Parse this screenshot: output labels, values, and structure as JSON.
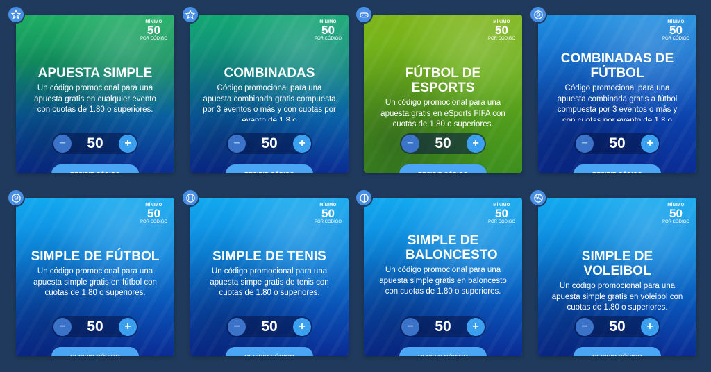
{
  "cards": [
    {
      "icon": "star-icon",
      "minimo_label": "MÍNIMO",
      "minimo_value": "50",
      "minimo_sub": "POR CÓDIGO",
      "title": "APUESTA SIMPLE",
      "description": "Un código promocional para una apuesta gratis en cualquier evento con cuotas de 1.80 o superiores.",
      "stepper_value": "50",
      "button_label": "RECIBIR CÓDIGO"
    },
    {
      "icon": "star-icon",
      "minimo_label": "MÍNIMO",
      "minimo_value": "50",
      "minimo_sub": "POR CÓDIGO",
      "title": "COMBINADAS",
      "description": "Código promocional para una apuesta combinada gratis compuesta por 3 eventos o más y con cuotas por evento de 1.8 o",
      "stepper_value": "50",
      "button_label": "RECIBIR CÓDIGO"
    },
    {
      "icon": "esports-icon",
      "minimo_label": "MÍNIMO",
      "minimo_value": "50",
      "minimo_sub": "POR CÓDIGO",
      "title": "FÚTBOL DE ESPORTS",
      "description": "Un código promocional para una apuesta gratis en eSports FIFA con cuotas de 1.80 o superiores.",
      "stepper_value": "50",
      "button_label": "RECIBIR CÓDIGO"
    },
    {
      "icon": "soccer-ball-icon",
      "minimo_label": "MÍNIMO",
      "minimo_value": "50",
      "minimo_sub": "POR CÓDIGO",
      "title": "COMBINADAS DE FÚTBOL",
      "description": "Código promocional para una apuesta combinada gratis a fútbol compuesta por 3 eventos o más y con cuotas por evento de 1.8 o",
      "stepper_value": "50",
      "button_label": "RECIBIR CÓDIGO"
    },
    {
      "icon": "soccer-ball-icon",
      "minimo_label": "MÍNIMO",
      "minimo_value": "50",
      "minimo_sub": "POR CÓDIGO",
      "title": "SIMPLE DE FÚTBOL",
      "description": "Un código promocional para una apuesta simple gratis en fútbol con cuotas de 1.80 o superiores.",
      "stepper_value": "50",
      "button_label": "RECIBIR CÓDIGO"
    },
    {
      "icon": "tennis-ball-icon",
      "minimo_label": "MÍNIMO",
      "minimo_value": "50",
      "minimo_sub": "POR CÓDIGO",
      "title": "SIMPLE DE TENIS",
      "description": "Un código promocional para una apuesta simpe gratis de tenis con cuotas de 1.80 o superiores.",
      "stepper_value": "50",
      "button_label": "RECIBIR CÓDIGO"
    },
    {
      "icon": "basketball-icon",
      "minimo_label": "MÍNIMO",
      "minimo_value": "50",
      "minimo_sub": "POR CÓDIGO",
      "title": "SIMPLE DE BALONCESTO",
      "description": "Un código promocional para una apuesta simple gratis en baloncesto con cuotas de 1.80 o superiores.",
      "stepper_value": "50",
      "button_label": "RECIBIR CÓDIGO"
    },
    {
      "icon": "volleyball-icon",
      "minimo_label": "MÍNIMO",
      "minimo_value": "50",
      "minimo_sub": "POR CÓDIGO",
      "title": "SIMPLE DE VOLEIBOL",
      "description": "Un código promocional para una apuesta simple gratis en voleibol con cuotas de 1.80 o superiores.",
      "stepper_value": "50",
      "button_label": "RECIBIR CÓDIGO"
    }
  ],
  "stepper": {
    "minus_symbol": "−",
    "plus_symbol": "+"
  },
  "colors": {
    "page_background": "#1f3a5c",
    "button_blue": "#4aa6f4",
    "badge_blue": "#4a8fe6"
  }
}
